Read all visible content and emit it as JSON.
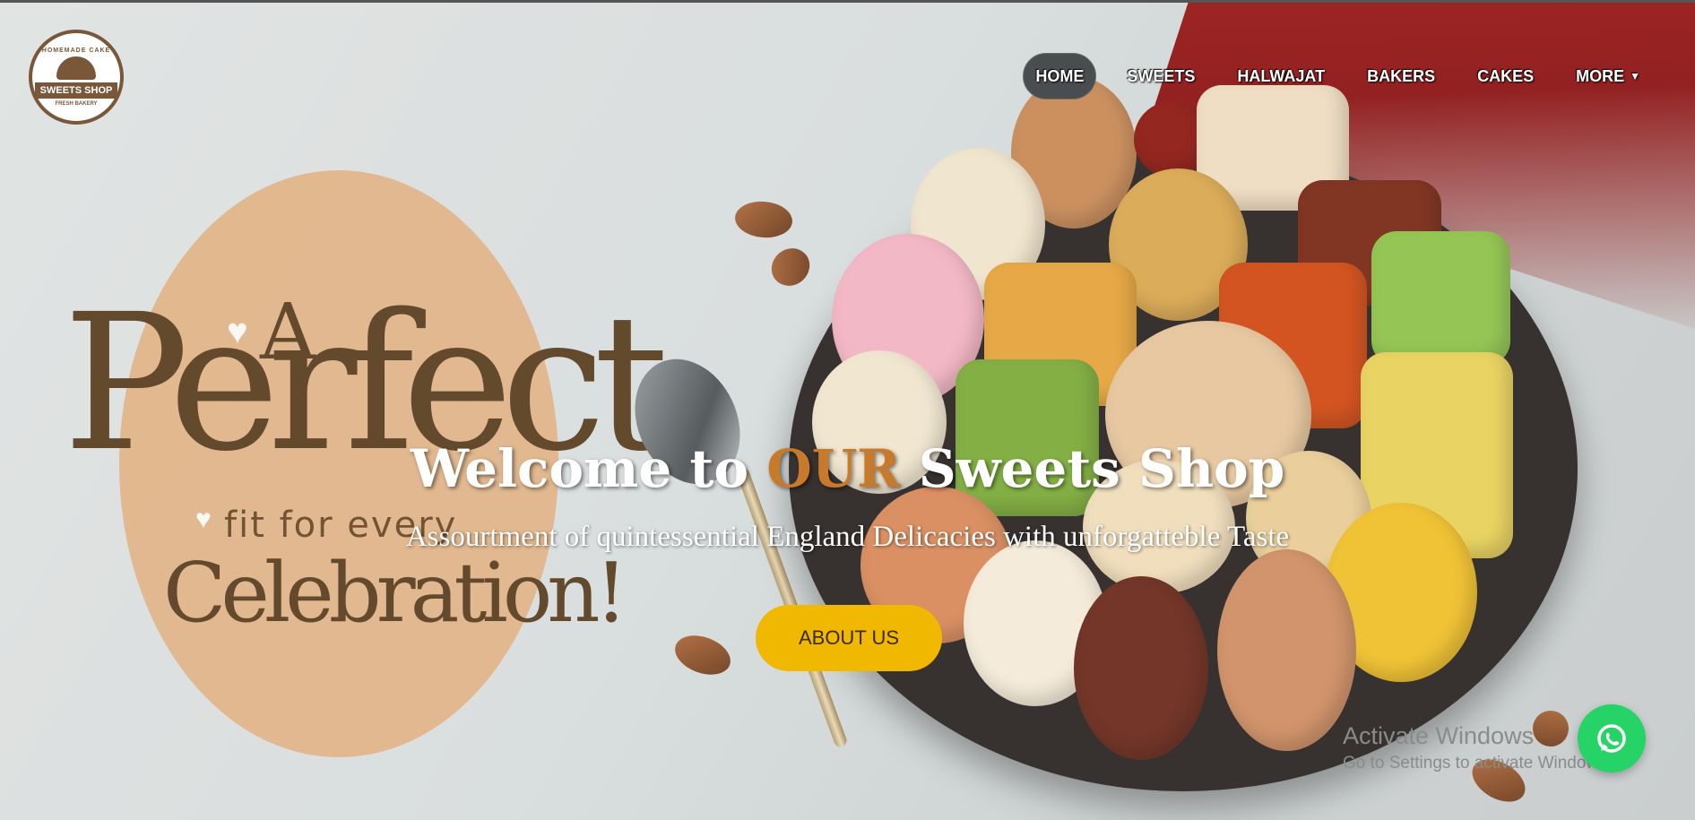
{
  "brand": {
    "logo_top": "HOMEMADE CAKE",
    "logo_name": "SWEETS SHOP",
    "logo_bottom": "FRESH BAKERY"
  },
  "nav": {
    "items": [
      {
        "label": "HOME",
        "active": true
      },
      {
        "label": "SWEETS"
      },
      {
        "label": "HALWAJAT"
      },
      {
        "label": "BAKERS"
      },
      {
        "label": "CAKES"
      },
      {
        "label": "MORE",
        "dropdown": true
      }
    ]
  },
  "hero": {
    "poster": {
      "a": "A",
      "perfect": "Perfect",
      "fit": "fit for every",
      "celebration": "Celebration!"
    },
    "headline_pre": "Welcome to ",
    "headline_accent": "OUR",
    "headline_post": " Sweets Shop",
    "subtitle": "Assourtment of quintessential England Delicacies with unforgatteble Taste",
    "cta_label": "ABOUT US"
  },
  "overlay": {
    "watermark_title": "Activate Windows",
    "watermark_sub": "Go to Settings to activate Windows."
  },
  "icons": {
    "whatsapp": "whatsapp-icon",
    "dropdown": "caret-down-icon"
  },
  "colors": {
    "accent": "#c77a2c",
    "button": "#f0b800",
    "whatsapp": "#25d366"
  }
}
